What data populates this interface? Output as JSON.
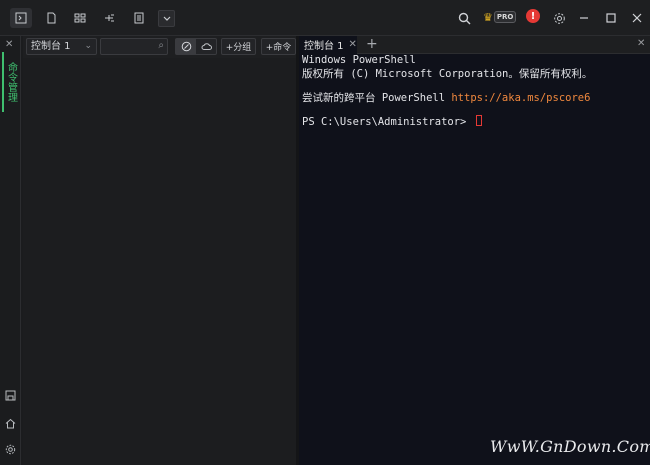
{
  "titlebar": {
    "tools": [
      "terminal-icon",
      "file-icon",
      "network-icon",
      "tree-icon",
      "list-icon",
      "chevron-down-icon"
    ],
    "pro_label": "PRO",
    "alert_label": "!"
  },
  "activity": {
    "label": "命令管理"
  },
  "panel": {
    "console_select": "控制台 1",
    "search_placeholder": "",
    "add_group": "+分组",
    "add_command": "+命令"
  },
  "terminal": {
    "tab_label": "控制台 1",
    "lines": [
      "Windows PowerShell",
      "版权所有 (C) Microsoft Corporation。保留所有权利。",
      "尝试新的跨平台 PowerShell ",
      "PS C:\\Users\\Administrator> "
    ],
    "link": "https://aka.ms/pscore6"
  },
  "watermark": "WwW.GnDown.Com"
}
